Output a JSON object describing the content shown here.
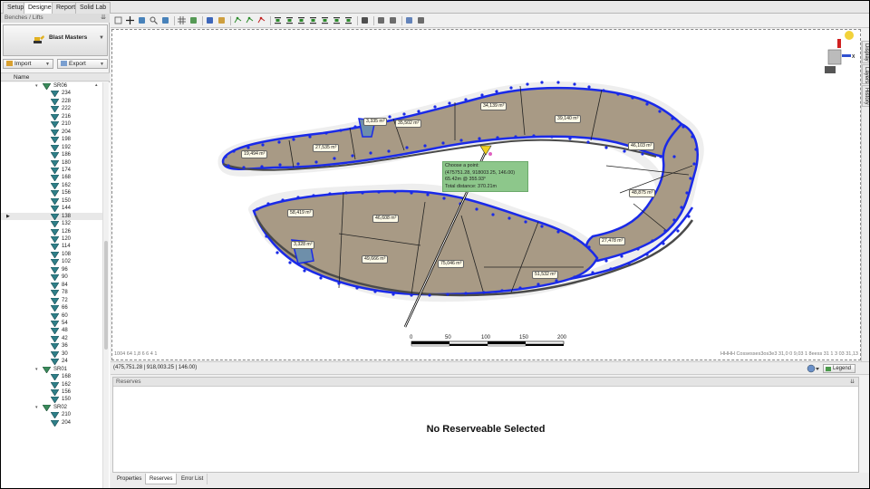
{
  "top_tabs": [
    {
      "label": "Setup"
    },
    {
      "label": "Designer"
    },
    {
      "label": "Report"
    },
    {
      "label": "Solid Lab"
    }
  ],
  "left_panel": {
    "title": "Benches / Lifts",
    "pin": "⇊",
    "company": "Blast Masters",
    "import_label": "Import",
    "export_label": "Export",
    "tree_column": "Name",
    "groups": [
      {
        "name": "SR06",
        "items": [
          "234",
          "228",
          "222",
          "216",
          "210",
          "204",
          "198",
          "192",
          "186",
          "180",
          "174",
          "168",
          "162",
          "156",
          "150",
          "144",
          "138",
          "132",
          "126",
          "120",
          "114",
          "108",
          "102",
          "96",
          "90",
          "84",
          "78",
          "72",
          "66",
          "60",
          "54",
          "48",
          "42",
          "36",
          "30",
          "24"
        ]
      },
      {
        "name": "SR01",
        "items": [
          "168",
          "162",
          "156",
          "150"
        ]
      },
      {
        "name": "SR02",
        "items": [
          "210",
          "204"
        ]
      }
    ],
    "selected_item": "138"
  },
  "canvas": {
    "labels": [
      "3,335 m³",
      "35,502 m³",
      "34,139 m³",
      "39,140 m³",
      "27,535 m³",
      "19,494 m³",
      "46,103 m³",
      "58,419 m³",
      "46,608 m³",
      "48,875 m³",
      "3,328 m³",
      "49,666 m³",
      "75,046 m³",
      "27,478 m³",
      "51,532 m³"
    ],
    "tooltip": {
      "line1": "Choose a point:",
      "line2": "(475751.28, 918003.25, 146.00)",
      "line3": "65.42m @ 355.93°",
      "line4": "Total distance: 370.21m"
    },
    "scale_labels": [
      "0",
      "50",
      "100",
      "150",
      "200"
    ],
    "faint_left": "1004 64 1,8 6 6 4 1",
    "faint_right": "HHHH Cossesses3os3e3 31,0 0 9,03 1 8eess 31 1 3 03 31,13",
    "axis_x": "X"
  },
  "right_tabs": [
    "Display",
    "Layers",
    "History"
  ],
  "status": {
    "coords": "(475,751.28 | 918,003.25 | 146.00)",
    "legend_label": "Legend"
  },
  "reserves": {
    "title": "Reserves",
    "pin": "⇊",
    "message": "No Reserveable Selected"
  },
  "bottom_tabs": [
    {
      "label": "Properties"
    },
    {
      "label": "Reserves"
    },
    {
      "label": "Error List"
    }
  ],
  "colors": {
    "pit_fill": "#a89a85",
    "pit_line": "#1a2ae8",
    "tooltip_bg": "#8dc78b",
    "small_block": "#6e8faa"
  }
}
